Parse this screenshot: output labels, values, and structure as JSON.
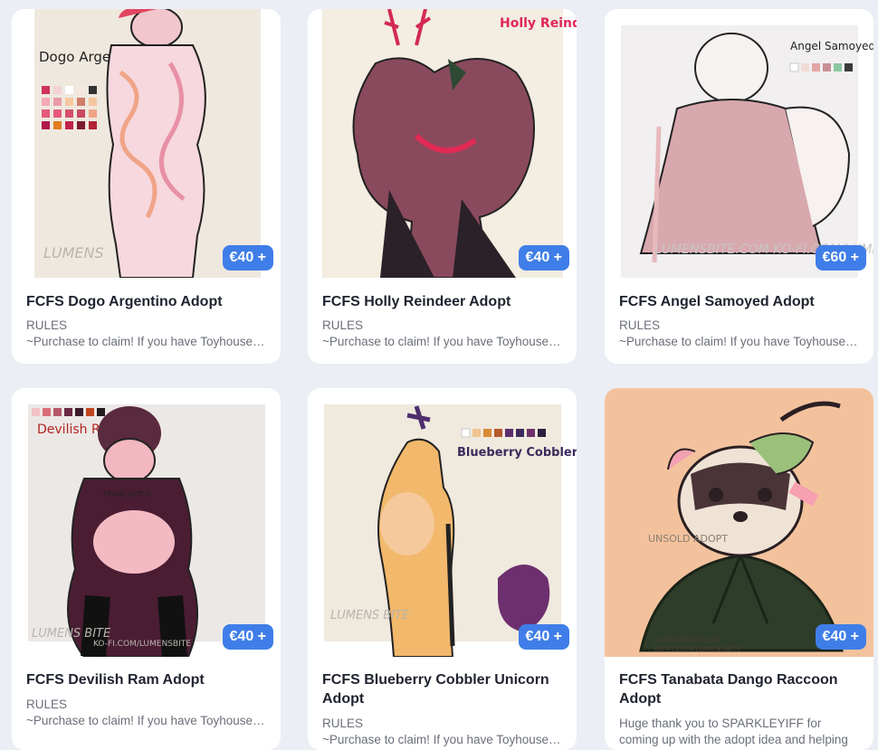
{
  "cards": [
    {
      "title": "FCFS Dogo Argentino Adopt",
      "price": "€40 +",
      "rules": "RULES",
      "desc": "~Purchase to claim! If you have Toyhouse, please",
      "art_text": "Dogo Argentino",
      "watermark": "LUMENS"
    },
    {
      "title": "FCFS Holly Reindeer Adopt",
      "price": "€40 +",
      "rules": "RULES",
      "desc": "~Purchase to claim! If you have Toyhouse, please",
      "art_text": "Holly Reindeer"
    },
    {
      "title": "FCFS Angel Samoyed Adopt",
      "price": "€60 +",
      "rules": "RULES",
      "desc": "~Purchase to claim! If you have Toyhouse, please",
      "art_text": "Angel Samoyed",
      "watermark": "LUMENSBITE.COM KO-FI.COM/LUMENS"
    },
    {
      "title": "FCFS Devilish Ram Adopt",
      "price": "€40 +",
      "rules": "RULES",
      "desc": "~Purchase to claim! If you have Toyhouse, please",
      "art_text": "Devilish Ram",
      "art_text2": "TRANS BITCH",
      "watermark": "LUMENS BITE",
      "watermark2": "KO-FI.COM/LUMENSBITE"
    },
    {
      "title_line1": "FCFS Blueberry Cobbler Unicorn",
      "title_line2": "Adopt",
      "price": "€40 +",
      "rules": "RULES",
      "desc": "~Purchase to claim! If you have Toyhouse, please",
      "art_text": "Blueberry Cobbler Unicorn",
      "watermark": "LUMENS BITE"
    },
    {
      "title_line1": "FCFS Tanabata Dango Raccoon",
      "title_line2": "Adopt",
      "price": "€40 +",
      "desc_line1": "Huge thank you to SPARKLEYIFF for",
      "desc_line2": "coming up with the adopt idea and helping",
      "art_text": "UNSOLD ADOPT",
      "watermark": "LUMENSBITE.COM",
      "watermark2": "KO-FI.COM/LUMENSBITE"
    }
  ],
  "colors": {
    "accent": "#3f7ee8",
    "bg": "#ebeef4"
  }
}
